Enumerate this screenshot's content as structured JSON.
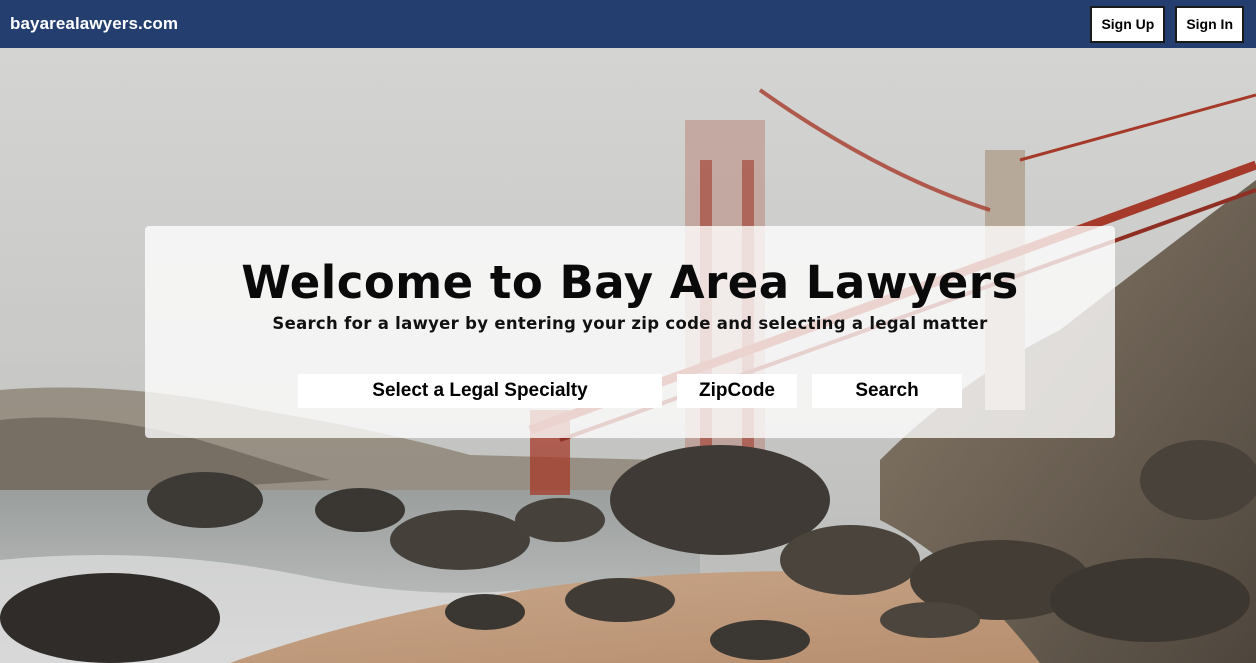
{
  "nav": {
    "brand": "bayarealawyers.com",
    "sign_up_label": "Sign Up",
    "sign_in_label": "Sign In"
  },
  "hero": {
    "background": "golden-gate-bridge-beach-photo",
    "title": "Welcome to Bay Area Lawyers",
    "subtitle": "Search for a lawyer by entering your zip code and selecting a legal matter",
    "specialty_select": "Select a Legal Specialty",
    "zip_input": "ZipCode",
    "search_button": "Search"
  },
  "colors": {
    "navbar": "#243f6f",
    "bridge": "#a63a2a"
  }
}
